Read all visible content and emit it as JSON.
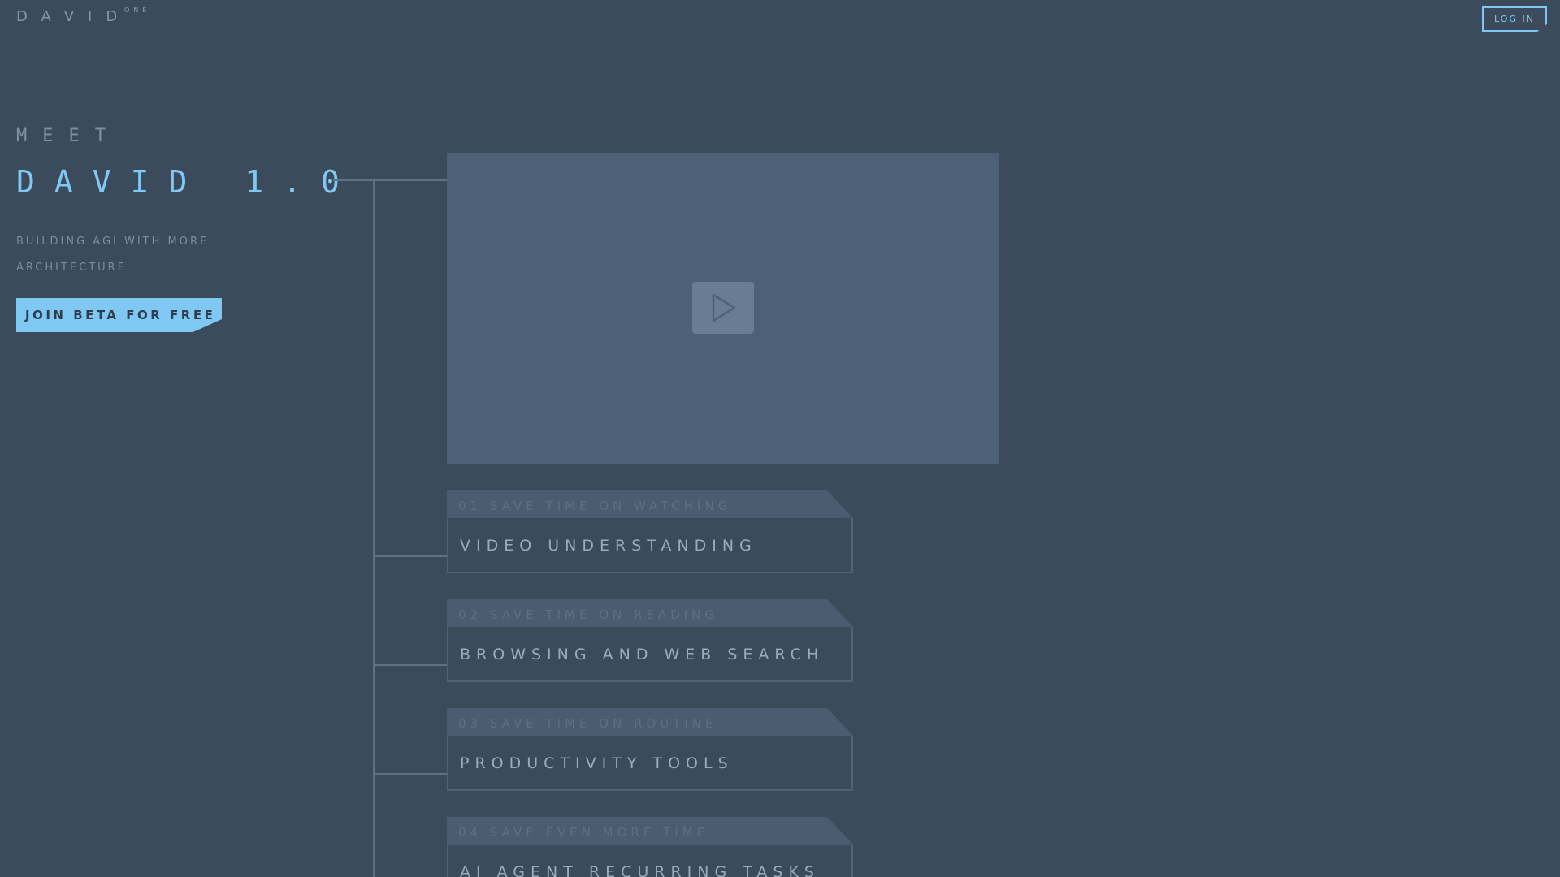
{
  "header": {
    "logo": "DAVID",
    "logo_sup": "ONE",
    "login_label": "LOG IN"
  },
  "hero": {
    "meet": "MEET",
    "title": "DAVID 1.0",
    "tagline_line1": "BUILDING AGI WITH MORE",
    "tagline_line2": "ARCHITECTURE",
    "cta_label": "JOIN BETA FOR FREE"
  },
  "video": {
    "play_icon": "play-icon"
  },
  "features": [
    {
      "label": "01 SAVE TIME ON WATCHING",
      "title": "VIDEO UNDERSTANDING"
    },
    {
      "label": "02 SAVE TIME ON READING",
      "title": "BROWSING AND WEB SEARCH"
    },
    {
      "label": "03 SAVE TIME ON ROUTINE",
      "title": "PRODUCTIVITY TOOLS"
    },
    {
      "label": "04 SAVE EVEN MORE TIME",
      "title": "AI AGENT RECURRING TASKS"
    }
  ],
  "colors": {
    "background": "#3b4b5b",
    "accent": "#7fc8f3",
    "panel": "#4e6075"
  }
}
